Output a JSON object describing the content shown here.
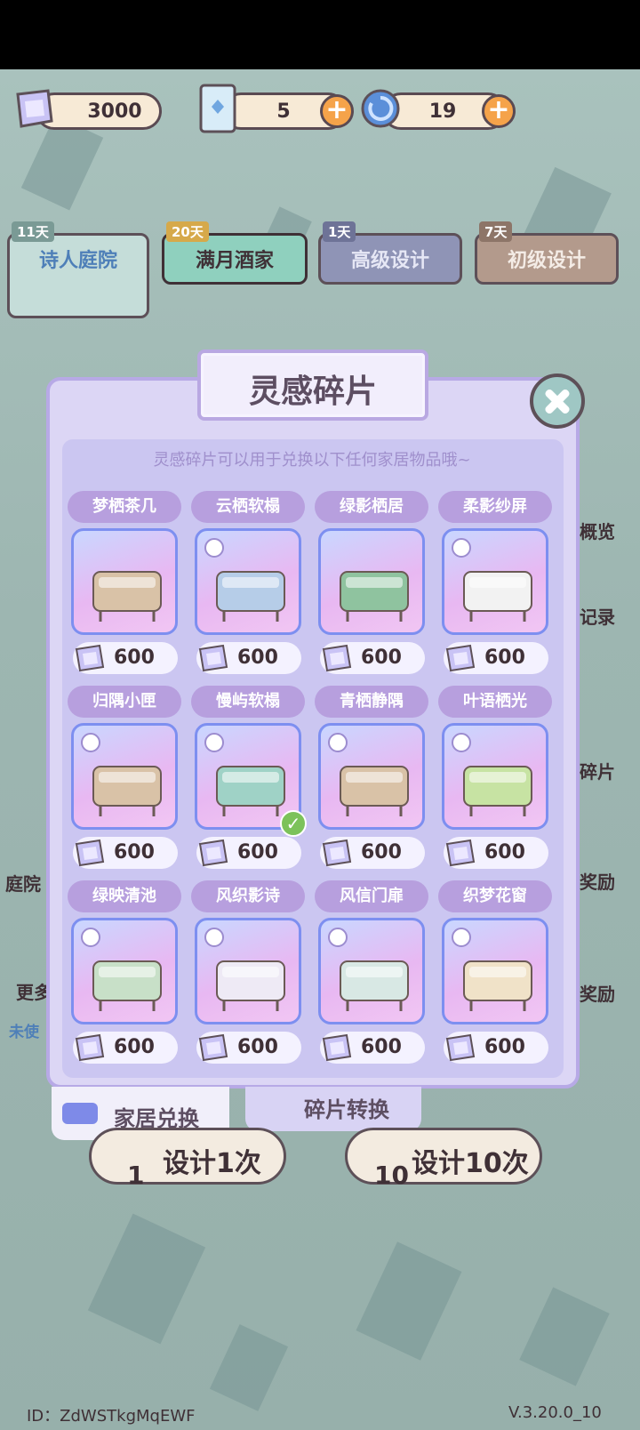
{
  "currency": {
    "fragments": "3000",
    "tickets": "5",
    "swirl": "19"
  },
  "banners": [
    {
      "days": "11天",
      "label": "诗人庭院"
    },
    {
      "days": "20天",
      "label": "满月酒家"
    },
    {
      "days": "1天",
      "label": "高级设计"
    },
    {
      "days": "7天",
      "label": "初级设计"
    }
  ],
  "side": {
    "left_top": "庭院",
    "left_mid": "更多",
    "left_bottom": "未使",
    "right_1": "概览",
    "right_2": "记录",
    "right_3": "碎片",
    "right_4": "奖励",
    "right_5": "奖励"
  },
  "modal": {
    "title": "灵感碎片",
    "description": "灵感碎片可以用于兑换以下任何家居物品哦~",
    "items": [
      {
        "name": "梦栖茶几",
        "price": "600",
        "owned": false
      },
      {
        "name": "云栖软榻",
        "price": "600",
        "owned": false
      },
      {
        "name": "绿影栖居",
        "price": "600",
        "owned": false
      },
      {
        "name": "柔影纱屏",
        "price": "600",
        "owned": false
      },
      {
        "name": "归隅小匣",
        "price": "600",
        "owned": false
      },
      {
        "name": "慢屿软榻",
        "price": "600",
        "owned": true
      },
      {
        "name": "青栖静隅",
        "price": "600",
        "owned": false
      },
      {
        "name": "叶语栖光",
        "price": "600",
        "owned": false
      },
      {
        "name": "绿映清池",
        "price": "600",
        "owned": false
      },
      {
        "name": "风织影诗",
        "price": "600",
        "owned": false
      },
      {
        "name": "风信门扉",
        "price": "600",
        "owned": false
      },
      {
        "name": "织梦花窗",
        "price": "600",
        "owned": false
      }
    ]
  },
  "bottom_tabs": {
    "furniture_exchange": "家居兑换",
    "fragment_convert": "碎片转换"
  },
  "design_buttons": {
    "once_label": "设计1次",
    "once_count": "1",
    "ten_label": "设计10次",
    "ten_count": "10"
  },
  "footer": {
    "id": "ID：ZdWSTkgMqEWF",
    "version": "V.3.20.0_10"
  }
}
